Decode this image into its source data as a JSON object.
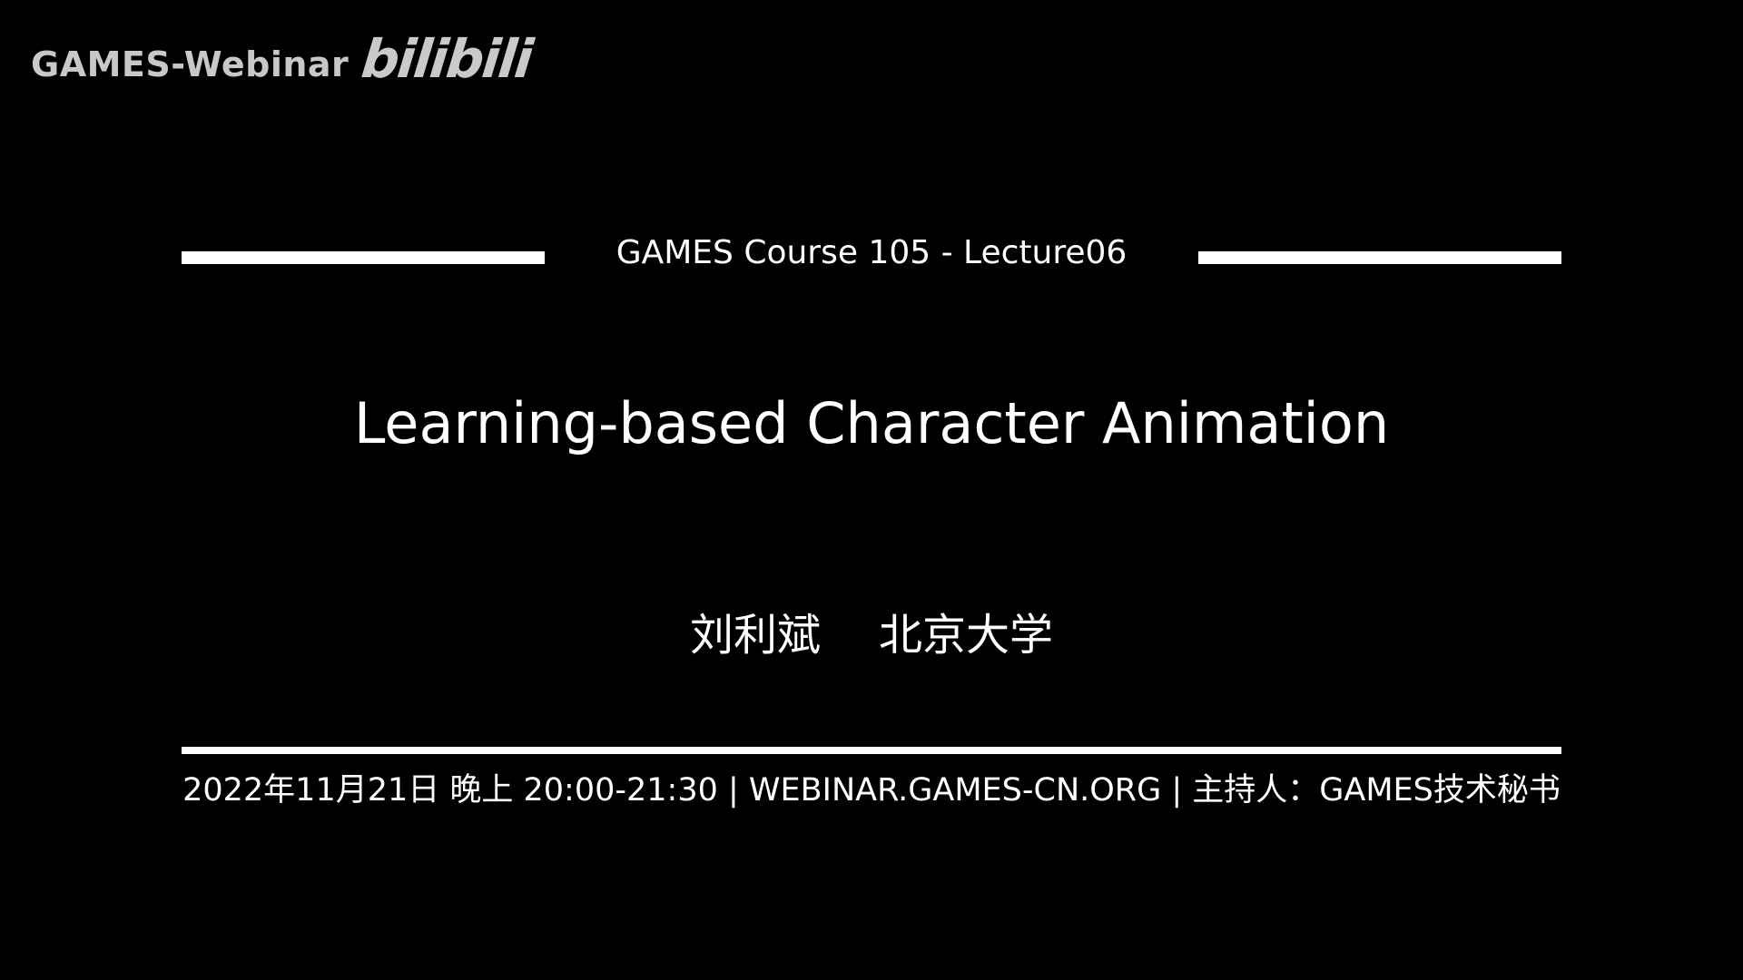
{
  "watermark": {
    "channel": "GAMES-Webinar",
    "platform_logo": "bilibili"
  },
  "slide": {
    "course_label": "GAMES Course 105 - Lecture06",
    "title": "Learning-based Character Animation",
    "speaker": {
      "name": "刘利斌",
      "affiliation": "北京大学"
    },
    "footer": "2022年11月21日 晚上 20:00-21:30 | WEBINAR.GAMES-CN.ORG | 主持人：GAMES技术秘书"
  },
  "colors": {
    "background": "#000000",
    "text": "#ffffff",
    "rule": "#ffffff"
  }
}
